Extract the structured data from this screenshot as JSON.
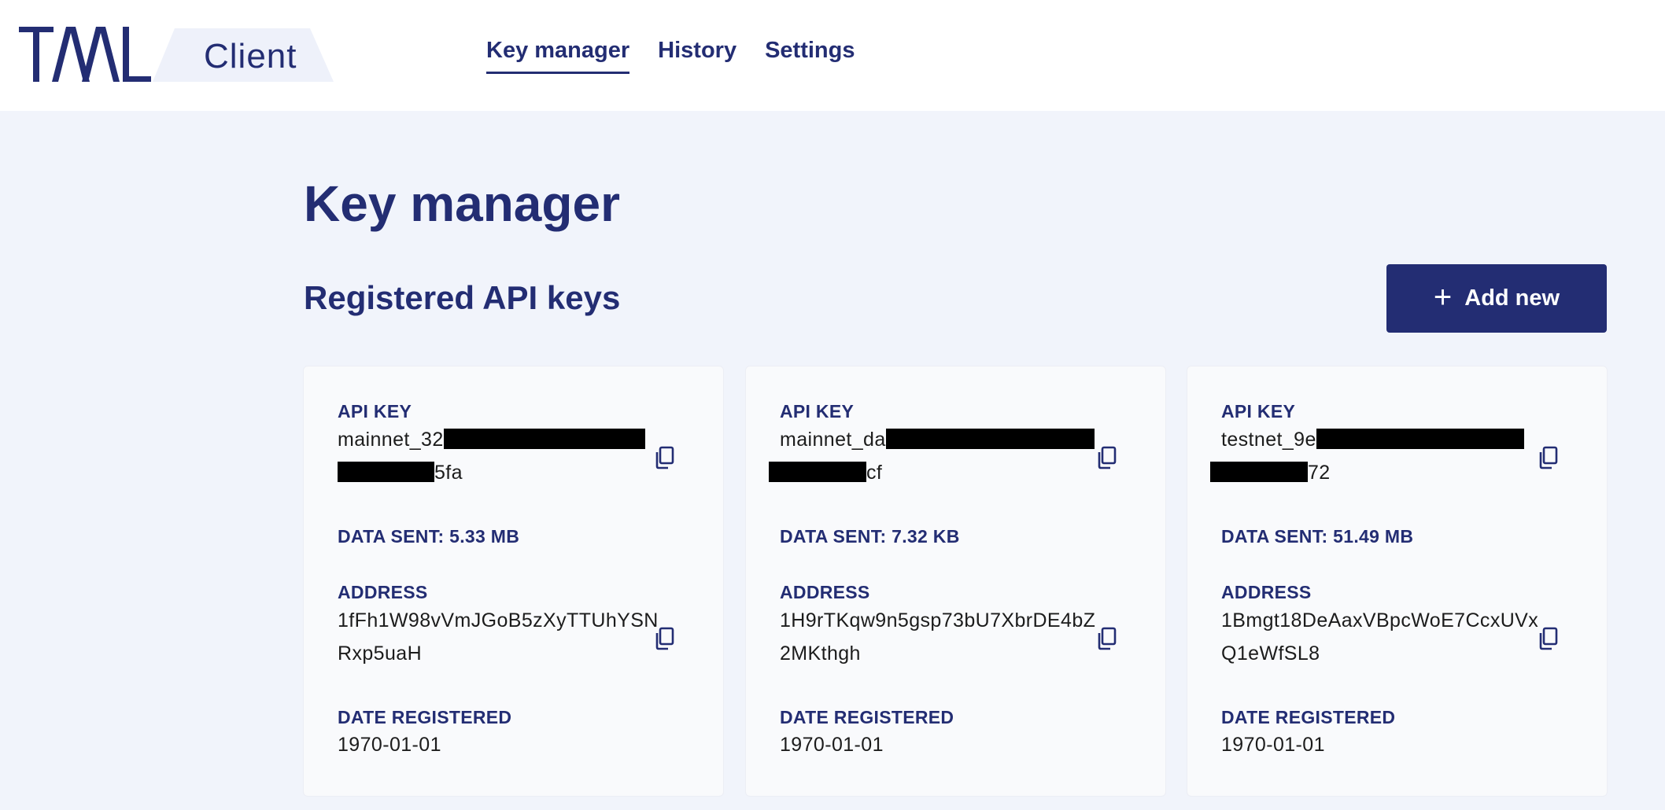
{
  "brand": {
    "name": "TAAL",
    "product": "Client"
  },
  "nav": [
    {
      "label": "Key manager",
      "active": true
    },
    {
      "label": "History",
      "active": false
    },
    {
      "label": "Settings",
      "active": false
    }
  ],
  "page": {
    "title": "Key manager",
    "section_title": "Registered API keys",
    "add_button": "Add new"
  },
  "labels": {
    "api_key": "API KEY",
    "address": "ADDRESS",
    "date_registered": "DATE REGISTERED"
  },
  "cards": [
    {
      "key_start": "mainnet_32",
      "key_end": "5fa",
      "data_sent": "DATA SENT: 5.33 MB",
      "address_line1": "1fFh1W98vVmJGoB5zXyTTUhYSN",
      "address_line2": "Rxp5uaH",
      "date": "1970-01-01"
    },
    {
      "key_start": "mainnet_da",
      "key_end": "cf",
      "data_sent": "DATA SENT: 7.32 KB",
      "address_line1": "1H9rTKqw9n5gsp73bU7XbrDE4bZ",
      "address_line2": "2MKthgh",
      "date": "1970-01-01"
    },
    {
      "key_start": "testnet_9e",
      "key_end": "72",
      "data_sent": "DATA SENT: 51.49 MB",
      "address_line1": "1Bmgt18DeAaxVBpcWoE7CcxUVx",
      "address_line2": "Q1eWfSL8",
      "date": "1970-01-01"
    }
  ],
  "colors": {
    "brand_navy": "#232d73",
    "page_bg": "#f1f4fb",
    "card_bg": "#f9fafc",
    "logo_tag_bg": "#eef1fa"
  },
  "icons": {
    "copy": "copy-icon",
    "add": "plus-icon"
  }
}
